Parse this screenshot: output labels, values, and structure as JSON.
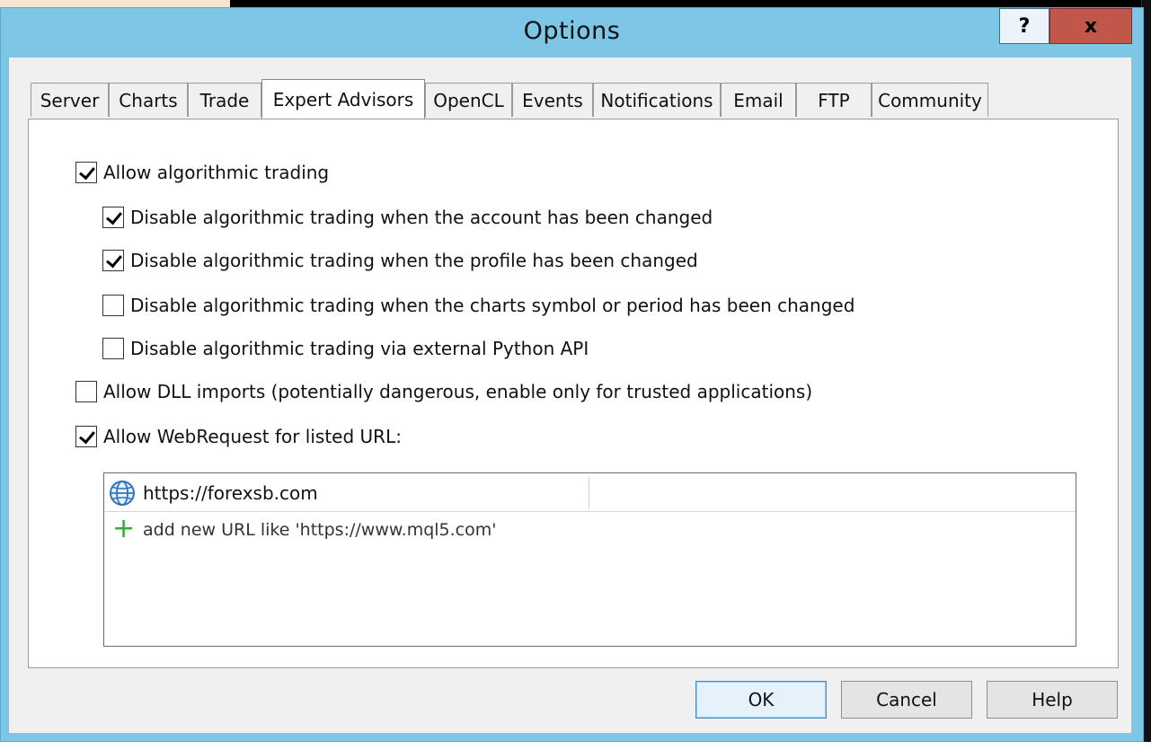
{
  "window": {
    "title": "Options",
    "help_label": "?",
    "close_label": "x"
  },
  "tabs": [
    {
      "label": "Server"
    },
    {
      "label": "Charts"
    },
    {
      "label": "Trade"
    },
    {
      "label": "Expert Advisors",
      "active": true
    },
    {
      "label": "OpenCL"
    },
    {
      "label": "Events"
    },
    {
      "label": "Notifications"
    },
    {
      "label": "Email"
    },
    {
      "label": "FTP"
    },
    {
      "label": "Community"
    }
  ],
  "options": {
    "allow_algo": {
      "label": "Allow algorithmic trading",
      "checked": true
    },
    "disable_account": {
      "label": "Disable algorithmic trading when the account has been changed",
      "checked": true
    },
    "disable_profile": {
      "label": "Disable algorithmic trading when the profile has been changed",
      "checked": true
    },
    "disable_symbol": {
      "label": "Disable algorithmic trading when the charts symbol or period has been changed",
      "checked": false
    },
    "disable_python": {
      "label": "Disable algorithmic trading via external Python API",
      "checked": false
    },
    "allow_dll": {
      "label": "Allow DLL imports (potentially dangerous, enable only for trusted applications)",
      "checked": false
    },
    "allow_webrequest": {
      "label": "Allow WebRequest for listed URL:",
      "checked": true
    }
  },
  "url_list": {
    "urls": [
      "https://forexsb.com"
    ],
    "add_placeholder": "add new URL like 'https://www.mql5.com'",
    "url_icon": "globe-icon",
    "add_icon": "plus-icon",
    "add_symbol": "+"
  },
  "buttons": {
    "ok": "OK",
    "cancel": "Cancel",
    "help": "Help"
  },
  "colors": {
    "title_bar": "#7ec6e6",
    "close_button": "#c1564a",
    "add_icon": "#3aa83a",
    "globe_icon": "#2f74c0"
  }
}
